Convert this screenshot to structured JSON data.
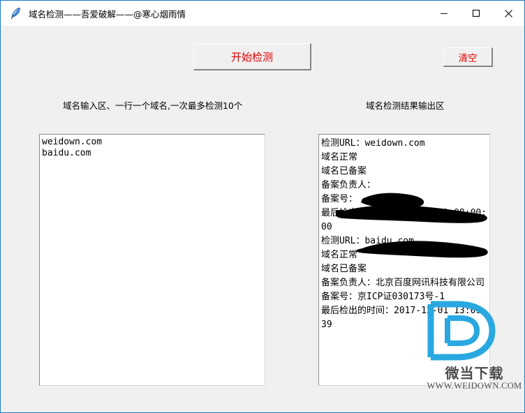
{
  "window": {
    "title": "域名检测——吾爱破解——@寒心烟雨情",
    "icon": "feather-quill-icon",
    "border_color": "#1a7dc4",
    "controls": {
      "minimize": "minimize-icon",
      "maximize": "maximize-icon",
      "close": "close-icon"
    }
  },
  "toolbar": {
    "start_label": "开始检测",
    "clear_label": "清空",
    "button_text_color": "#e00000"
  },
  "labels": {
    "input_section": "域名输入区、一行一个域名,一次最多检测10个",
    "output_section": "域名检测结果输出区"
  },
  "input_box": {
    "value": "weidown.com\nbaidu.com",
    "placeholder": ""
  },
  "output_box": {
    "value": "检测URL：weidown.com\n域名正常\n域名已备案\n备案负责人：\n备案号：\n最后检出的时间：1970-01-01 08:00:00\n检测URL：baidu.com\n域名正常\n域名已备案\n备案负责人：北京百度网讯科技有限公司\n备案号：京ICP证030173号-1\n最后检出的时间：2017-12-01 13:09:39",
    "redactions": "hand-drawn black marker strokes covering 备案负责人 and 备案号 values"
  },
  "watermark": {
    "logo": "letter-d-logo",
    "name_cn": "微当下载",
    "url": "WWW.WEIDOWN.COM",
    "logo_color": "#29a8e0",
    "text_color": "#4d4d4d"
  }
}
